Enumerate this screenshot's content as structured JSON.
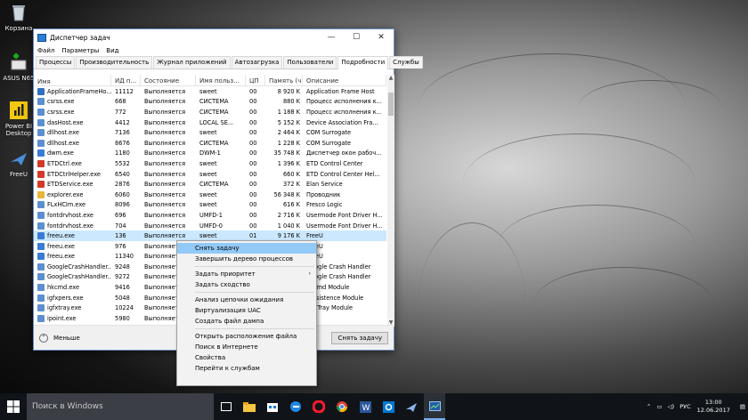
{
  "desktop": {
    "icons": [
      {
        "label": "Корзина"
      },
      {
        "label": "ASUS N65"
      },
      {
        "label": "Power BI Desktop"
      },
      {
        "label": "FreeU"
      }
    ]
  },
  "window": {
    "title": "Диспетчер задач",
    "menu": [
      "Файл",
      "Параметры",
      "Вид"
    ],
    "tabs": [
      "Процессы",
      "Производительность",
      "Журнал приложений",
      "Автозагрузка",
      "Пользователи",
      "Подробности",
      "Службы"
    ],
    "active_tab": "Подробности",
    "columns": [
      "Имя",
      "ИД п...",
      "Состояние",
      "Имя польз...",
      "ЦП",
      "Память (ч...",
      "Описание"
    ],
    "rows": [
      {
        "name": "ApplicationFrameHo...",
        "pid": "11112",
        "status": "Выполняется",
        "user": "sweet",
        "cpu": "00",
        "mem": "8 920 K",
        "desc": "Application Frame Host",
        "color": "#2f6fc0"
      },
      {
        "name": "csrss.exe",
        "pid": "668",
        "status": "Выполняется",
        "user": "СИСТЕМА",
        "cpu": "00",
        "mem": "880 K",
        "desc": "Процесс исполнения к...",
        "color": "#5b8fd0"
      },
      {
        "name": "csrss.exe",
        "pid": "772",
        "status": "Выполняется",
        "user": "СИСТЕМА",
        "cpu": "00",
        "mem": "1 188 K",
        "desc": "Процесс исполнения к...",
        "color": "#5b8fd0"
      },
      {
        "name": "dasHost.exe",
        "pid": "4412",
        "status": "Выполняется",
        "user": "LOCAL SE...",
        "cpu": "00",
        "mem": "5 152 K",
        "desc": "Device Association Fra...",
        "color": "#5b8fd0"
      },
      {
        "name": "dllhost.exe",
        "pid": "7136",
        "status": "Выполняется",
        "user": "sweet",
        "cpu": "00",
        "mem": "2 464 K",
        "desc": "COM Surrogate",
        "color": "#5b8fd0"
      },
      {
        "name": "dllhost.exe",
        "pid": "8676",
        "status": "Выполняется",
        "user": "СИСТЕМА",
        "cpu": "00",
        "mem": "1 228 K",
        "desc": "COM Surrogate",
        "color": "#5b8fd0"
      },
      {
        "name": "dwm.exe",
        "pid": "1180",
        "status": "Выполняется",
        "user": "DWM-1",
        "cpu": "00",
        "mem": "35 748 K",
        "desc": "Диспетчер окон рабоч...",
        "color": "#3a7bd5"
      },
      {
        "name": "ETDCtrl.exe",
        "pid": "5532",
        "status": "Выполняется",
        "user": "sweet",
        "cpu": "00",
        "mem": "1 396 K",
        "desc": "ETD Control Center",
        "color": "#d23a2a"
      },
      {
        "name": "ETDCtrlHelper.exe",
        "pid": "6540",
        "status": "Выполняется",
        "user": "sweet",
        "cpu": "00",
        "mem": "660 K",
        "desc": "ETD Control Center Hel...",
        "color": "#d23a2a"
      },
      {
        "name": "ETDService.exe",
        "pid": "2876",
        "status": "Выполняется",
        "user": "СИСТЕМА",
        "cpu": "00",
        "mem": "372 K",
        "desc": "Elan Service",
        "color": "#d23a2a"
      },
      {
        "name": "explorer.exe",
        "pid": "6060",
        "status": "Выполняется",
        "user": "sweet",
        "cpu": "00",
        "mem": "56 348 K",
        "desc": "Проводник",
        "color": "#e9b63a"
      },
      {
        "name": "FLxHCIm.exe",
        "pid": "8096",
        "status": "Выполняется",
        "user": "sweet",
        "cpu": "00",
        "mem": "616 K",
        "desc": "Fresco Logic",
        "color": "#5b8fd0"
      },
      {
        "name": "fontdrvhost.exe",
        "pid": "696",
        "status": "Выполняется",
        "user": "UMFD-1",
        "cpu": "00",
        "mem": "2 716 K",
        "desc": "Usermode Font Driver H...",
        "color": "#5b8fd0"
      },
      {
        "name": "fontdrvhost.exe",
        "pid": "704",
        "status": "Выполняется",
        "user": "UMFD-0",
        "cpu": "00",
        "mem": "1 040 K",
        "desc": "Usermode Font Driver H...",
        "color": "#5b8fd0"
      },
      {
        "name": "freeu.exe",
        "pid": "136",
        "status": "Выполняется",
        "user": "sweet",
        "cpu": "01",
        "mem": "9 176 K",
        "desc": "FreeU",
        "color": "#3a7bd5",
        "selected": true
      },
      {
        "name": "freeu.exe",
        "pid": "976",
        "status": "Выполняется",
        "user": "",
        "cpu": "",
        "mem": "",
        "desc": "FreeU",
        "color": "#3a7bd5"
      },
      {
        "name": "freeu.exe",
        "pid": "11340",
        "status": "Выполняется",
        "user": "",
        "cpu": "",
        "mem": "",
        "desc": "FreeU",
        "color": "#3a7bd5"
      },
      {
        "name": "GoogleCrashHandler...",
        "pid": "9248",
        "status": "Выполняется",
        "user": "",
        "cpu": "",
        "mem": "",
        "desc": "Google Crash Handler",
        "color": "#5b8fd0"
      },
      {
        "name": "GoogleCrashHandler...",
        "pid": "9272",
        "status": "Выполняется",
        "user": "",
        "cpu": "",
        "mem": "",
        "desc": "Google Crash Handler",
        "color": "#5b8fd0"
      },
      {
        "name": "hkcmd.exe",
        "pid": "9416",
        "status": "Выполняется",
        "user": "",
        "cpu": "",
        "mem": "",
        "desc": "hkcmd Module",
        "color": "#5b8fd0"
      },
      {
        "name": "igfxpers.exe",
        "pid": "5048",
        "status": "Выполняется",
        "user": "",
        "cpu": "",
        "mem": "",
        "desc": "persistence Module",
        "color": "#5b8fd0"
      },
      {
        "name": "igfxtray.exe",
        "pid": "10224",
        "status": "Выполняется",
        "user": "",
        "cpu": "",
        "mem": "",
        "desc": "igfxTray Module",
        "color": "#5b8fd0"
      },
      {
        "name": "ipoint.exe",
        "pid": "5980",
        "status": "Выполняется",
        "user": "",
        "cpu": "",
        "mem": "",
        "desc": "",
        "color": "#5b8fd0"
      }
    ],
    "less_label": "Меньше",
    "end_task_button": "Снять задачу"
  },
  "context_menu": {
    "items": [
      {
        "label": "Снять задачу",
        "highlight": true
      },
      {
        "label": "Завершить дерево процессов"
      },
      {
        "sep": true
      },
      {
        "label": "Задать приоритет",
        "submenu": true
      },
      {
        "label": "Задать сходство"
      },
      {
        "sep": true
      },
      {
        "label": "Анализ цепочки ожидания"
      },
      {
        "label": "Виртуализация UAC"
      },
      {
        "label": "Создать файл дампа"
      },
      {
        "sep": true
      },
      {
        "label": "Открыть расположение файла"
      },
      {
        "label": "Поиск в Интернете"
      },
      {
        "label": "Свойства"
      },
      {
        "label": "Перейти к службам"
      }
    ]
  },
  "taskbar": {
    "search_placeholder": "Поиск в Windows",
    "language": "РУС",
    "time": "13:00",
    "date": "12.06.2017"
  }
}
